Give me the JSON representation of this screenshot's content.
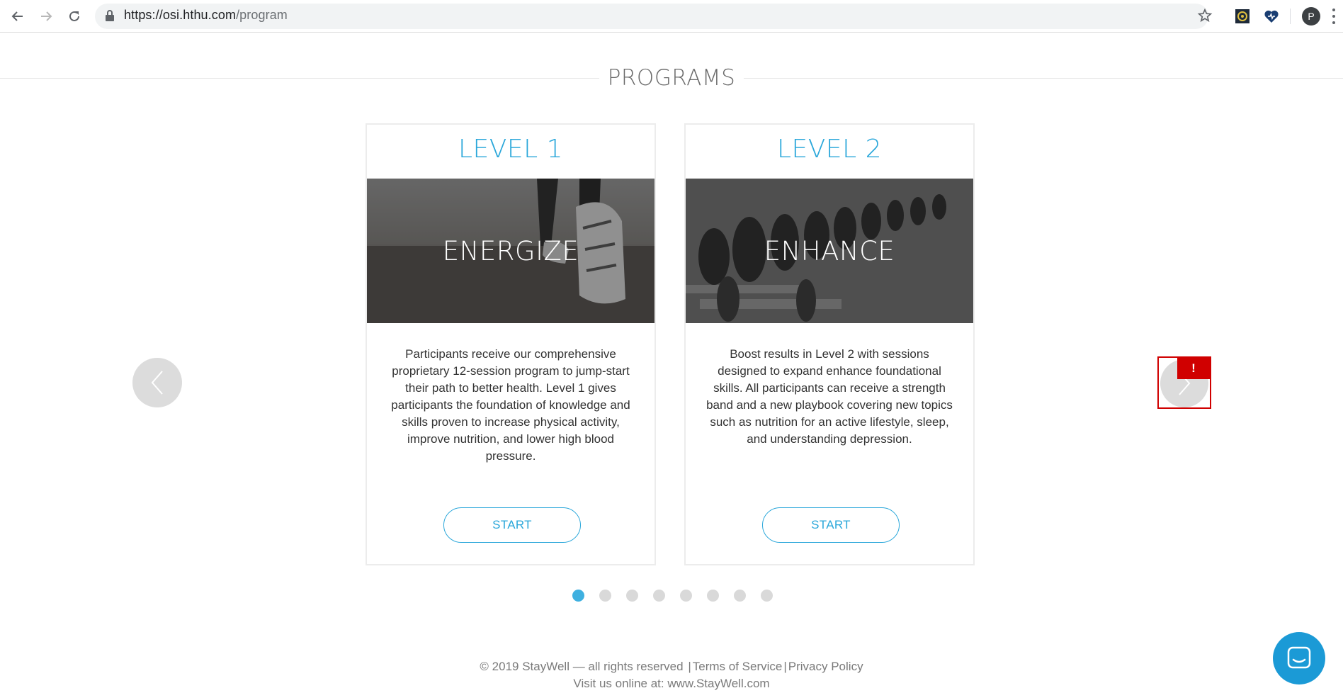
{
  "browser": {
    "url_host": "https://osi.hthu.com",
    "url_path": "/program",
    "profile_initial": "P",
    "icons": [
      "back-icon",
      "forward-icon",
      "reload-icon",
      "lock-icon",
      "bookmark-star-icon",
      "extension-icon",
      "extension-heart-icon",
      "menu-icon"
    ]
  },
  "page": {
    "title": "PROGRAMS"
  },
  "cards": [
    {
      "level": "LEVEL 1",
      "image_label": "ENERGIZE",
      "description": "Participants receive our comprehensive proprietary 12-session program to jump-start their path to better health. Level 1 gives participants the foundation of knowledge and skills proven to increase physical activity, improve nutrition, and lower high blood pressure.",
      "button": "START"
    },
    {
      "level": "LEVEL 2",
      "image_label": "ENHANCE",
      "description": "Boost results in Level 2 with sessions designed to expand enhance foundational skills. All participants can receive a strength band and a new playbook covering new topics such as nutrition for an active lifestyle, sleep, and understanding depression.",
      "button": "START"
    }
  ],
  "carousel": {
    "total_dots": 8,
    "active_index": 0,
    "alert_badge": "!"
  },
  "footer": {
    "copyright": "©  2019  StayWell  —  all rights reserved",
    "terms": "Terms of Service",
    "privacy": "Privacy Policy",
    "visit": "Visit us online at: www.StayWell.com"
  },
  "colors": {
    "accent": "#2aa7da",
    "active_dot": "#3fb0e0",
    "alert": "#d00000",
    "chat": "#1b9ad6"
  }
}
